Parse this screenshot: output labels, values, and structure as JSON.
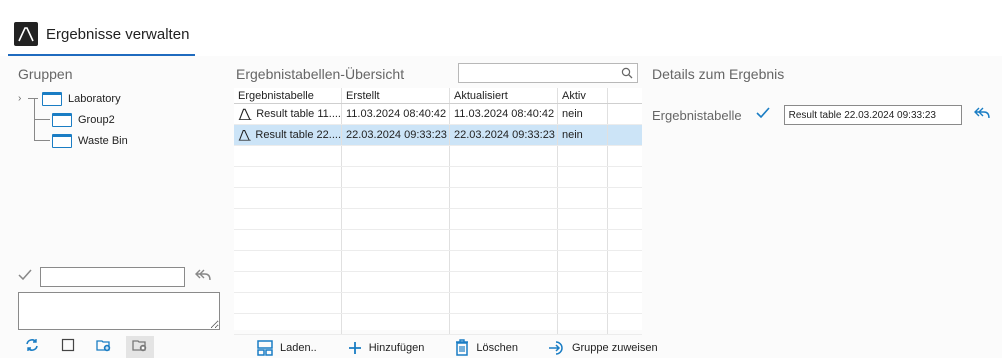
{
  "app": {
    "tab_title": "Ergebnisse verwalten"
  },
  "left_panel": {
    "title": "Gruppen",
    "tree": [
      {
        "label": "Laboratory",
        "expandable": true
      },
      {
        "label": "Group2",
        "expandable": false
      },
      {
        "label": "Waste Bin",
        "expandable": false
      }
    ],
    "edit_value": "",
    "comment_value": "",
    "toolbar": [
      "refresh-icon",
      "checkbox-icon",
      "add-folder-icon",
      "remove-folder-icon"
    ]
  },
  "middle_panel": {
    "title": "Ergebnistabellen-Übersicht",
    "search_value": "",
    "columns": [
      "Ergebnistabelle",
      "Erstellt",
      "Aktualisiert",
      "Aktiv",
      ""
    ],
    "rows": [
      {
        "name": "Result table 11....",
        "created": "11.03.2024 08:40:42",
        "updated": "11.03.2024 08:40:42",
        "active": "nein",
        "selected": false
      },
      {
        "name": "Result table 22....",
        "created": "22.03.2024 09:33:23",
        "updated": "22.03.2024 09:33:23",
        "active": "nein",
        "selected": true
      }
    ],
    "toolbar": {
      "load": "Laden..",
      "add": "Hinzufügen",
      "delete": "Löschen",
      "assign": "Gruppe zuweisen"
    }
  },
  "right_panel": {
    "title": "Details zum Ergebnis",
    "label": "Ergebnistabelle",
    "value": "Result table 22.03.2024 09:33:23"
  },
  "colors": {
    "accent": "#1f6bbf",
    "folder": "#1a7dc4",
    "selection": "#cce4f7"
  }
}
